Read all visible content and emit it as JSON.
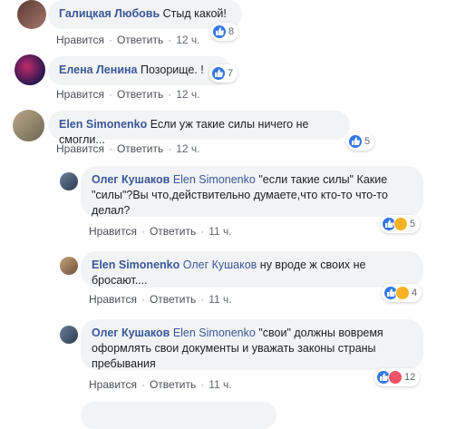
{
  "comments": [
    {
      "author": "Галицкая Любовь",
      "mention": "",
      "text": "Стыд какой!",
      "like": "Нравится",
      "reply": "Ответить",
      "time": "12 ч.",
      "count": "8"
    },
    {
      "author": "Елена Ленина",
      "mention": "",
      "text": "Позорище. !",
      "like": "Нравится",
      "reply": "Ответить",
      "time": "12 ч.",
      "count": "7"
    },
    {
      "author": "Elen Simonenko",
      "mention": "",
      "text": "Если уж такие силы ничего не смогли...",
      "like": "Нравится",
      "reply": "Ответить",
      "time": "12 ч.",
      "count": "5"
    },
    {
      "author": "Олег Кушаков",
      "mention": "Elen Simonenko",
      "text": "\"если такие силы\" Какие \"силы\"?Вы что,действительно думаете,что кто-то что-то делал?",
      "like": "Нравится",
      "reply": "Ответить",
      "time": "11 ч.",
      "count": "5"
    },
    {
      "author": "Elen Simonenko",
      "mention": "Олег Кушаков",
      "text": "ну вроде ж своих не бросают....",
      "like": "Нравится",
      "reply": "Ответить",
      "time": "11 ч.",
      "count": "4"
    },
    {
      "author": "Олег Кушаков",
      "mention": "Elen Simonenko",
      "text": "\"свои\" должны вовремя оформлять свои документы и уважать законы страны пребывания",
      "like": "Нравится",
      "reply": "Ответить",
      "time": "11 ч.",
      "count": "12"
    }
  ],
  "colors": {
    "link": "#385898",
    "bubble": "#f2f3f5",
    "like": "#3578e5"
  }
}
